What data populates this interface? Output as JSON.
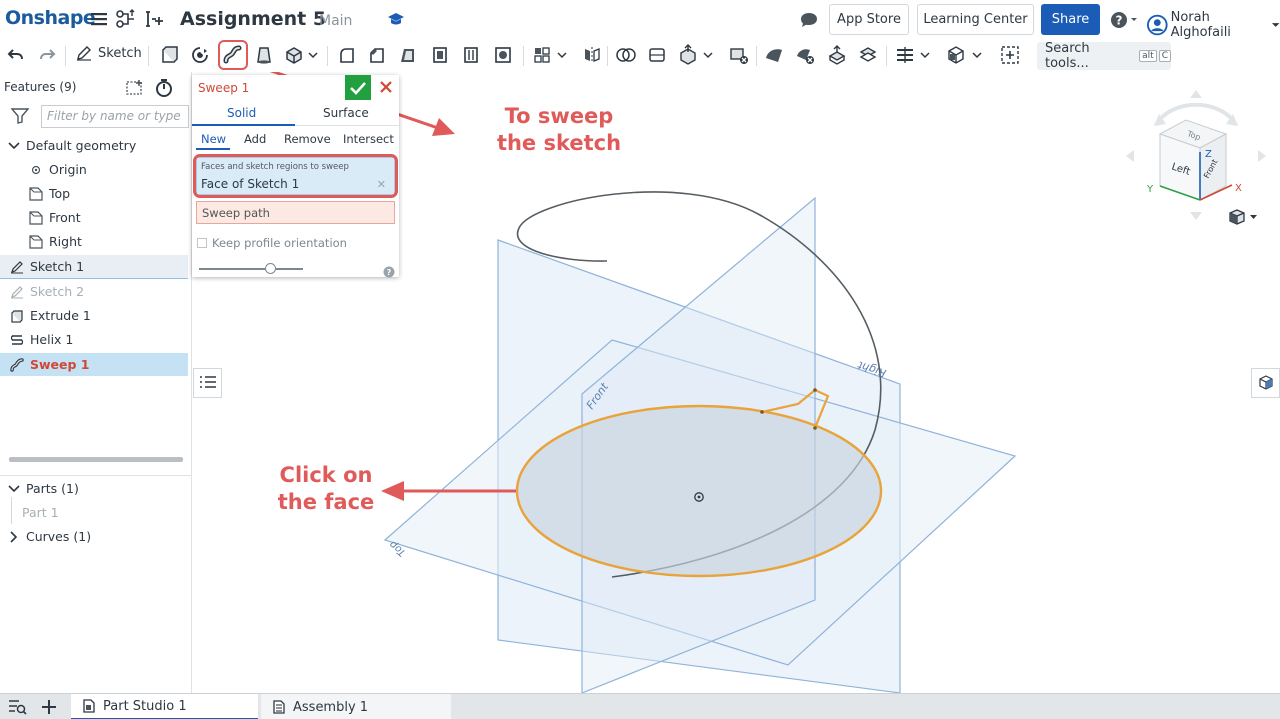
{
  "app": {
    "logo": "Onshape",
    "document_title": "Assignment 5",
    "branch": "Main"
  },
  "header": {
    "app_store": "App Store",
    "learning_center": "Learning Center",
    "share": "Share",
    "user_name": "Norah Alghofaili"
  },
  "toolbar": {
    "sketch_label": "Sketch",
    "search_label": "Search tools...",
    "search_shortcut_1": "alt",
    "search_shortcut_2": "C"
  },
  "features": {
    "header": "Features (9)",
    "filter_placeholder": "Filter by name or type",
    "default_geometry": "Default geometry",
    "origin": "Origin",
    "top": "Top",
    "front": "Front",
    "right": "Right",
    "sketch1": "Sketch 1",
    "sketch2": "Sketch 2",
    "extrude1": "Extrude 1",
    "helix1": "Helix 1",
    "sweep1": "Sweep 1"
  },
  "parts": {
    "parts_header": "Parts (1)",
    "part1": "Part 1",
    "curves_header": "Curves (1)"
  },
  "sweep_dialog": {
    "title": "Sweep 1",
    "tab_solid": "Solid",
    "tab_surface": "Surface",
    "op_new": "New",
    "op_add": "Add",
    "op_remove": "Remove",
    "op_intersect": "Intersect",
    "faces_label": "Faces and sketch regions to sweep",
    "faces_value": "Face of Sketch 1",
    "sweep_path": "Sweep path",
    "keep_orientation": "Keep profile orientation"
  },
  "annotations": {
    "sweep_line1": "To sweep",
    "sweep_line2": "the sketch",
    "click_line1": "Click on",
    "click_line2": "the face"
  },
  "viewport": {
    "plane_front": "Front",
    "plane_right": "Right",
    "plane_top": "Top",
    "cube_top": "Top",
    "cube_left": "Left",
    "cube_front": "Front",
    "axis_x": "X",
    "axis_y": "Y",
    "axis_z": "Z"
  },
  "bottom_tabs": {
    "part_studio": "Part Studio 1",
    "assembly": "Assembly 1"
  },
  "colors": {
    "brand_blue": "#1b5cb6",
    "annotation_red": "#df5a58",
    "highlight_orange": "#e8a33a",
    "plane_blue": "#8fb3d9",
    "ok_green": "#22a040"
  }
}
